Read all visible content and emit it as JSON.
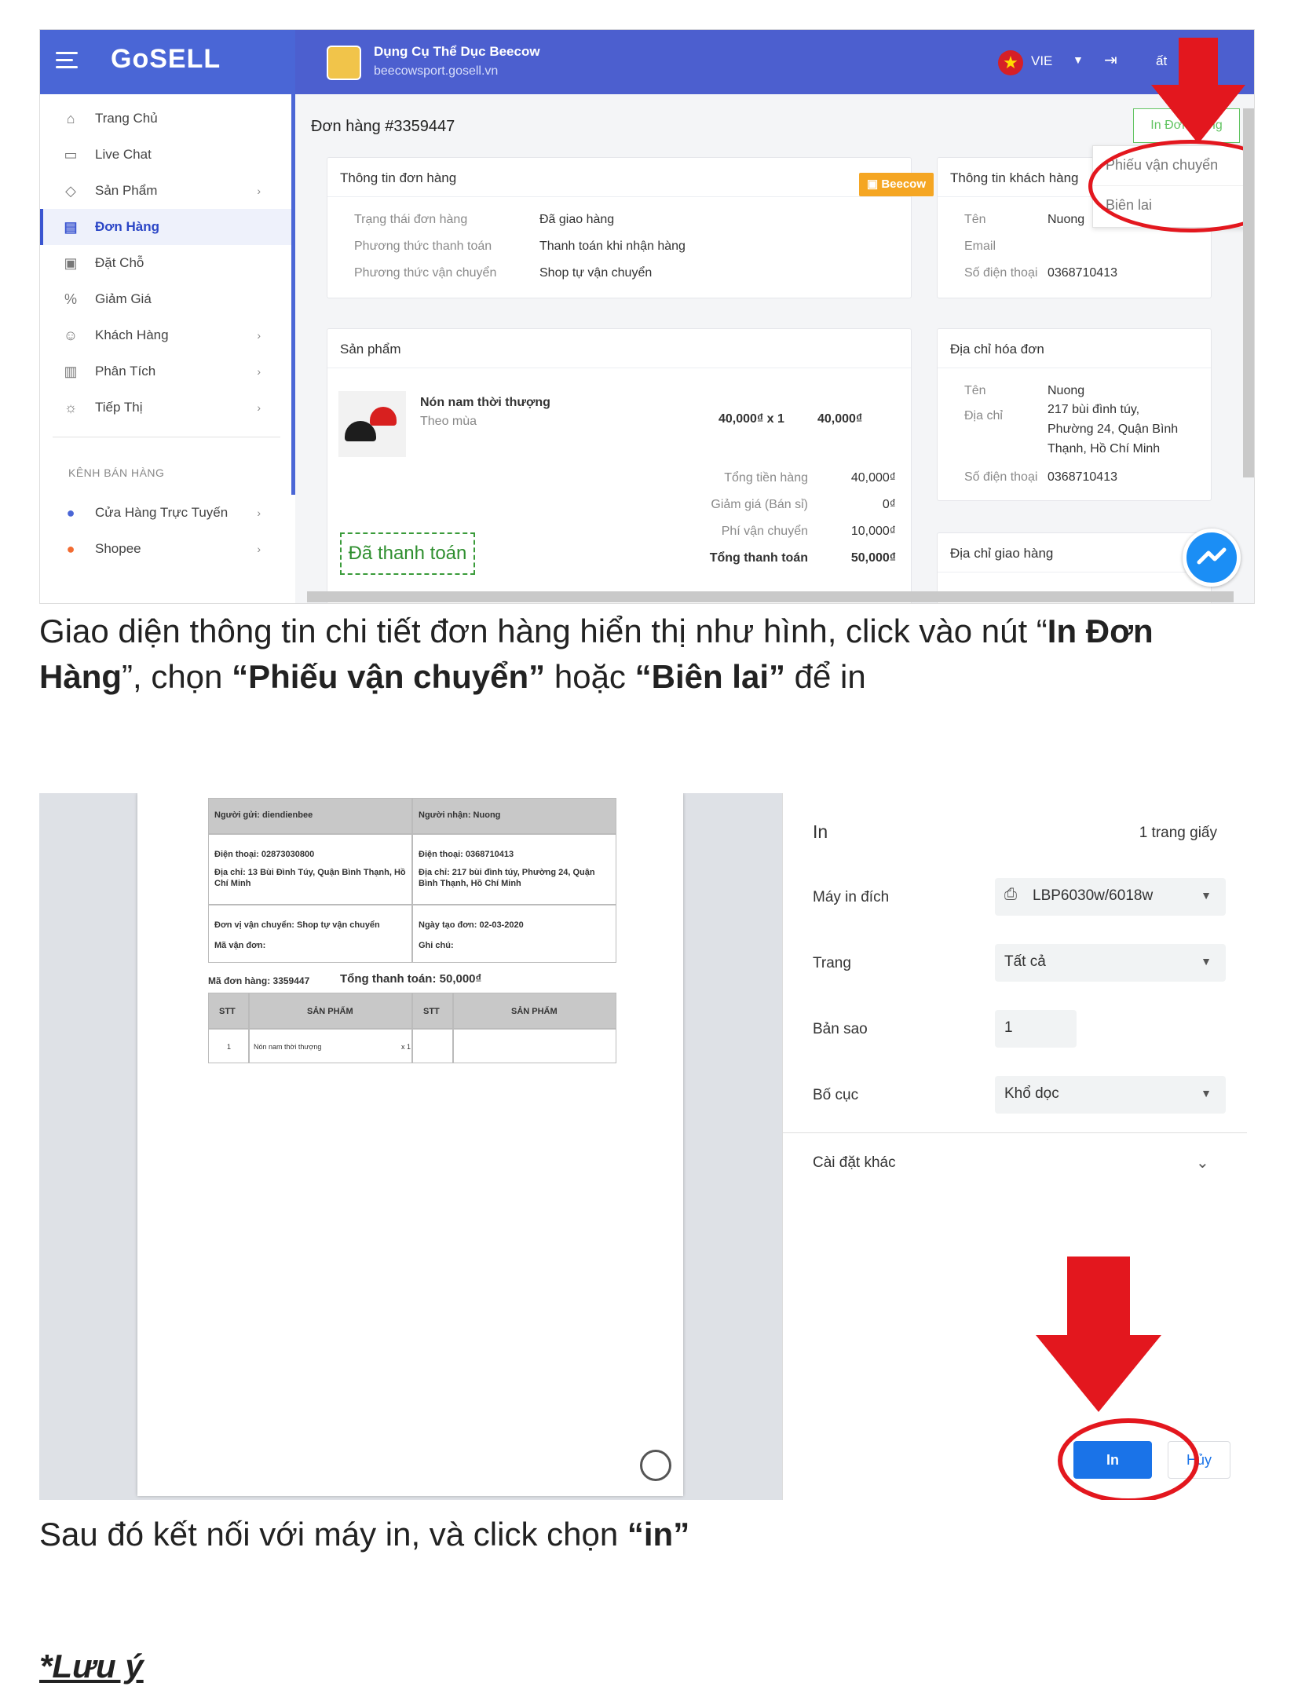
{
  "screenshot1": {
    "logo": "GoSELL",
    "store": {
      "name": "Dụng Cụ Thể Dục Beecow",
      "url": "beecowsport.gosell.vn"
    },
    "language": "VIE",
    "logout": "Đăng xuất",
    "sidebar": {
      "items": [
        {
          "label": "Trang Chủ",
          "icon": "home-icon"
        },
        {
          "label": "Live Chat",
          "icon": "chat-icon"
        },
        {
          "label": "Sản Phẩm",
          "icon": "tag-icon",
          "chevron": true
        },
        {
          "label": "Đơn Hàng",
          "icon": "order-icon",
          "active": true
        },
        {
          "label": "Đặt Chỗ",
          "icon": "calendar-icon"
        },
        {
          "label": "Giảm Giá",
          "icon": "discount-icon"
        },
        {
          "label": "Khách Hàng",
          "icon": "customers-icon",
          "chevron": true
        },
        {
          "label": "Phân Tích",
          "icon": "analytics-icon",
          "chevron": true
        },
        {
          "label": "Tiếp Thị",
          "icon": "marketing-icon",
          "chevron": true
        }
      ],
      "channels_heading": "KÊNH BÁN HÀNG",
      "channels": [
        {
          "label": "Cửa Hàng Trực Tuyến",
          "icon": "store-icon"
        },
        {
          "label": "Shopee",
          "icon": "shopee-icon"
        }
      ]
    },
    "order_title": "Đơn hàng #3359447",
    "print_button": "In Đơn Hàng",
    "print_menu": [
      "Phiếu vận chuyển",
      "Biên lai"
    ],
    "order_info": {
      "title": "Thông tin đơn hàng",
      "badge": "Beecow",
      "rows": [
        {
          "label": "Trạng thái đơn hàng",
          "value": "Đã giao hàng"
        },
        {
          "label": "Phương thức thanh toán",
          "value": "Thanh toán khi nhận hàng"
        },
        {
          "label": "Phương thức vận chuyển",
          "value": "Shop tự vận chuyển"
        }
      ]
    },
    "customer_info": {
      "title": "Thông tin khách hàng",
      "rows": [
        {
          "label": "Tên",
          "value": "Nuong"
        },
        {
          "label": "Email",
          "value": ""
        },
        {
          "label": "Số điện thoại",
          "value": "0368710413"
        }
      ]
    },
    "products": {
      "title": "Sản phẩm",
      "item": {
        "name": "Nón nam thời thượng",
        "variant": "Theo mùa",
        "qty_price": "40,000₫ x 1",
        "total": "40,000₫"
      },
      "summary": [
        {
          "label": "Tổng tiền hàng",
          "value": "40,000₫"
        },
        {
          "label": "Giảm giá (Bán sỉ)",
          "value": "0₫"
        },
        {
          "label": "Phí vận chuyển",
          "value": "10,000₫"
        },
        {
          "label": "Tổng thanh toán",
          "value": "50,000₫"
        }
      ],
      "paid_stamp": "Đã thanh toán"
    },
    "billing": {
      "title": "Địa chỉ hóa đơn",
      "name_label": "Tên",
      "name": "Nuong",
      "address_label": "Địa chỉ",
      "address_lines": [
        "217 bùi đình túy,",
        "Phường 24, Quận Bình",
        "Thạnh, Hồ Chí Minh"
      ],
      "phone_label": "Số điện thoại",
      "phone": "0368710413"
    },
    "shipping_title": "Địa chỉ giao hàng"
  },
  "caption1_parts": [
    "Giao diện thông tin chi tiết đơn hàng hiển thị như hình, click vào nút “",
    "In Đơn Hàng",
    "”, chọn ",
    "“Phiếu vận chuyển”",
    " hoặc ",
    "“Biên lai”",
    " để in"
  ],
  "screenshot2": {
    "slip": {
      "sender": "Người gửi: diendienbee",
      "receiver": "Người nhận: Nuong",
      "sender_phone": "Điện thoại: 02873030800",
      "sender_address": "Địa chỉ: 13 Bùi Đình Túy, Quận Bình Thạnh, Hồ Chí Minh",
      "receiver_phone": "Điện thoại: 0368710413",
      "receiver_address": "Địa chỉ: 217 bùi đình túy, Phường 24, Quận Bình Thạnh, Hồ Chí Minh",
      "carrier": "Đơn vị vận chuyển: Shop tự vận chuyển",
      "tracking": "Mã vận đơn:",
      "created": "Ngày tạo đơn: 02-03-2020",
      "note": "Ghi chú:",
      "order_code": "Mã đơn hàng: 3359447",
      "total": "Tổng thanh toán: 50,000₫",
      "col_stt": "STT",
      "col_product": "SẢN PHẨM",
      "row_no": "1",
      "row_product": "Nón nam thời thượng",
      "row_qty": "x 1"
    },
    "panel": {
      "title": "In",
      "pages": "1 trang giấy",
      "printer_label": "Máy in đích",
      "printer": "LBP6030w/6018w",
      "pages_label": "Trang",
      "pages_value": "Tất cả",
      "copies_label": "Bản sao",
      "copies": "1",
      "layout_label": "Bố cục",
      "layout": "Khổ dọc",
      "more_settings": "Cài đặt khác",
      "print": "In",
      "cancel": "Hủy"
    }
  },
  "caption2_parts": [
    "Sau đó kết nối với máy in, và click chọn ",
    "“in”"
  ],
  "note": "*Lưu ý",
  "colors": {
    "brand_blue": "#4a66d6",
    "annotation_red": "#e3171e",
    "paid_green": "#2f8f2f",
    "print_blue": "#1a73e8"
  }
}
